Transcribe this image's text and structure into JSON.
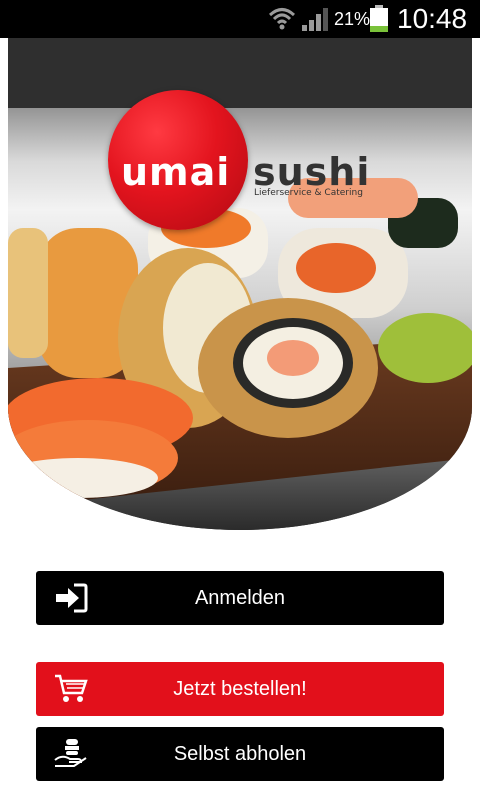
{
  "status_bar": {
    "battery_percent": "21%",
    "time": "10:48"
  },
  "logo": {
    "brand_part1": "umai",
    "brand_part2": "sushi",
    "tagline": "Lieferservice & Catering"
  },
  "actions": {
    "login_label": "Anmelden",
    "order_label": "Jetzt bestellen!",
    "pickup_label": "Selbst abholen"
  },
  "colors": {
    "accent": "#e2101b",
    "button_dark": "#000000"
  }
}
